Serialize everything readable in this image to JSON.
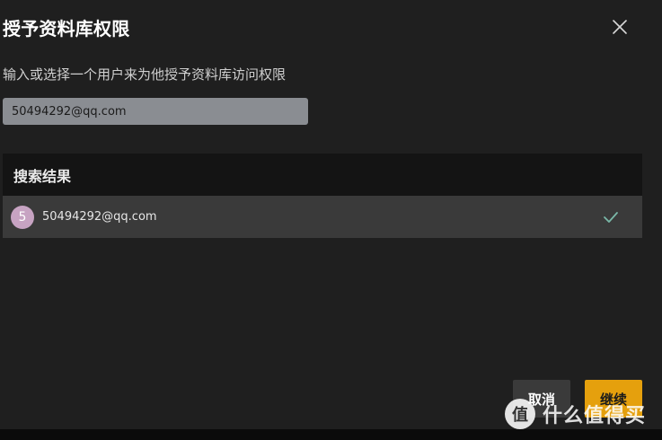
{
  "dialog": {
    "title": "授予资料库权限",
    "instruction": "输入或选择一个用户来为他授予资料库访问权限"
  },
  "search": {
    "value": "50494292@qq.com",
    "placeholder": ""
  },
  "results": {
    "header": "搜索结果",
    "items": [
      {
        "avatar_letter": "5",
        "email": "50494292@qq.com",
        "selected": true
      }
    ]
  },
  "buttons": {
    "cancel": "取消",
    "continue": "继续"
  },
  "watermark": {
    "logo": "值",
    "text": "什么值得买"
  },
  "colors": {
    "background": "#1f1f1f",
    "accent": "#e5a00d",
    "row_highlight": "#3a3a3a",
    "header_bg": "#141414",
    "avatar": "#c7a3c2",
    "check": "#7ab8a8"
  },
  "icons": {
    "close": "close-icon",
    "check": "check-icon"
  }
}
